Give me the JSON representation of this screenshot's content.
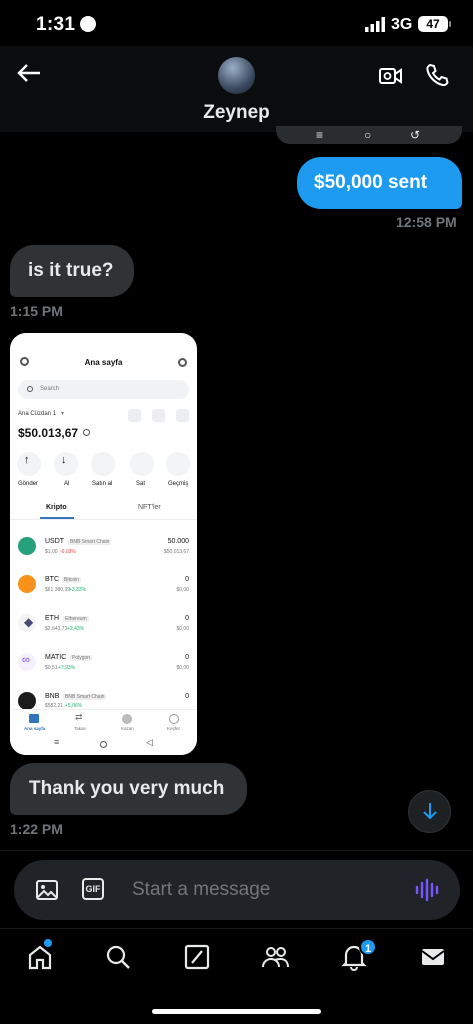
{
  "status": {
    "time": "1:31",
    "network": "3G",
    "battery": "47"
  },
  "header": {
    "contact_name": "Zeynep"
  },
  "messages": {
    "prev_nav": {
      "menu": "≡",
      "home": "○",
      "back": "↺"
    },
    "sent_1": {
      "text": "$50,000 sent",
      "time": "12:58 PM"
    },
    "received_1": {
      "text": "is it true?",
      "time": "1:15 PM"
    },
    "received_3": {
      "text": "Thank you very much",
      "time": "1:22 PM"
    }
  },
  "wallet": {
    "title": "Ana sayfa",
    "search_placeholder": "Search",
    "wallet_name": "Ana Cüzdan 1",
    "balance": "$50.013,67",
    "actions": [
      "Gönder",
      "Al",
      "Satın al",
      "Sat",
      "Geçmiş"
    ],
    "tabs": [
      "Kripto",
      "NFT'ler"
    ],
    "assets": [
      {
        "symbol": "USDT",
        "chain": "BNB Smart Chain",
        "price": "$1,00",
        "change": "-0,03%",
        "amount": "50.000",
        "value": "$50.013,67",
        "color": "#26a17b"
      },
      {
        "symbol": "BTC",
        "chain": "Bitcoin",
        "price": "$61.380,39",
        "change": "+3,33%",
        "amount": "0",
        "value": "$0,00",
        "color": "#f7931a"
      },
      {
        "symbol": "ETH",
        "chain": "Ethereum",
        "price": "$2.643,73",
        "change": "+2,43%",
        "amount": "0",
        "value": "$0,00",
        "color": "#454a75"
      },
      {
        "symbol": "MATIC",
        "chain": "Polygon",
        "price": "$0,51",
        "change": "+7,93%",
        "amount": "0",
        "value": "$0,00",
        "color": "#8247e5"
      },
      {
        "symbol": "BNB",
        "chain": "BNB Smart Chain",
        "price": "$582,21",
        "change": "+5,06%",
        "amount": "0",
        "value": "$0,00",
        "color": "#f0b90b"
      }
    ],
    "bottom_nav": [
      "Ana sayfa",
      "Takas",
      "Kazan",
      "Keşfet"
    ]
  },
  "composer": {
    "placeholder": "Start a message",
    "gif": "GIF"
  },
  "tabbar": {
    "notifications_badge": "1"
  },
  "colors": {
    "accent": "#1d9bf0",
    "positive": "#1bb36b",
    "negative": "#e0464c"
  }
}
